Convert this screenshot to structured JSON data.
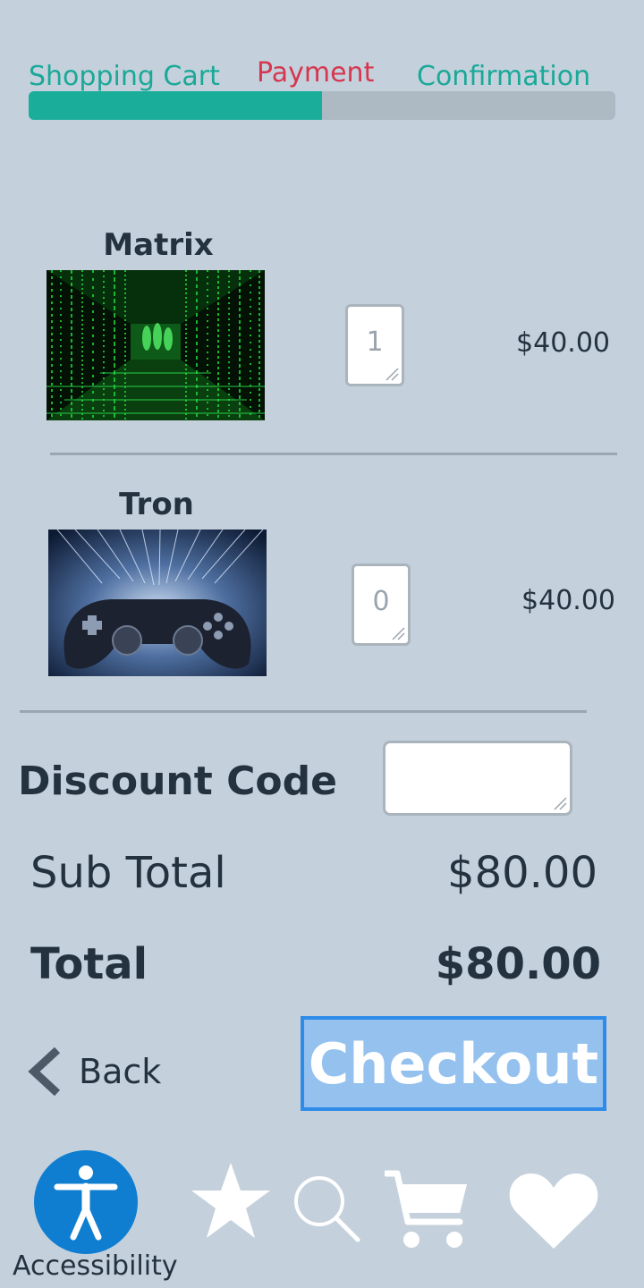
{
  "progress": {
    "steps": [
      "Shopping Cart",
      "Payment",
      "Confirmation"
    ],
    "current_step": "Payment",
    "fill_fraction": 0.5,
    "colors": {
      "done": "#1aa898",
      "current": "#d6364f",
      "fill": "#1aae9a",
      "track": "#adb9c3"
    }
  },
  "cart": {
    "items": [
      {
        "title": "Matrix",
        "quantity": "1",
        "price": "$40.00",
        "image_icon": "matrix-image"
      },
      {
        "title": "Tron",
        "quantity": "0",
        "price": "$40.00",
        "image_icon": "tron-controller-image"
      }
    ]
  },
  "discount": {
    "label": "Discount Code",
    "value": ""
  },
  "summary": {
    "subtotal_label": "Sub Total",
    "subtotal_value": "$80.00",
    "total_label": "Total",
    "total_value": "$80.00"
  },
  "actions": {
    "back_label": "Back",
    "checkout_label": "Checkout"
  },
  "bottom_nav": {
    "accessibility_label": "Accessibility",
    "icons": [
      "accessibility-icon",
      "star-icon",
      "search-icon",
      "cart-icon",
      "heart-icon"
    ],
    "accent": "#0f7ed1"
  }
}
